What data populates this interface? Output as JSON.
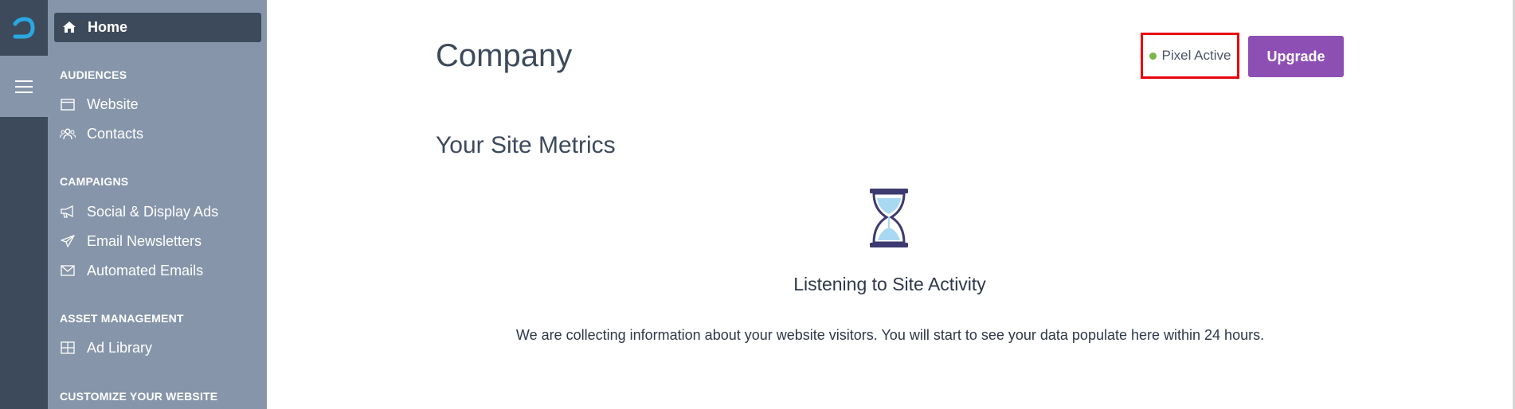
{
  "nav": {
    "logo_icon": "brand-logo-icon",
    "menu_icon": "hamburger-icon",
    "home": {
      "label": "Home",
      "icon": "home-icon"
    },
    "sections": [
      {
        "title": "AUDIENCES",
        "items": [
          {
            "label": "Website",
            "icon": "browser-window-icon"
          },
          {
            "label": "Contacts",
            "icon": "users-icon"
          }
        ]
      },
      {
        "title": "CAMPAIGNS",
        "items": [
          {
            "label": "Social & Display Ads",
            "icon": "megaphone-icon"
          },
          {
            "label": "Email Newsletters",
            "icon": "paper-plane-icon"
          },
          {
            "label": "Automated Emails",
            "icon": "envelope-icon"
          }
        ]
      },
      {
        "title": "ASSET MANAGEMENT",
        "items": [
          {
            "label": "Ad Library",
            "icon": "grid-icon"
          }
        ]
      },
      {
        "title": "CUSTOMIZE YOUR WEBSITE",
        "items": []
      }
    ]
  },
  "header": {
    "title": "Company",
    "pixel_status": "Pixel Active",
    "pixel_status_color": "#7ab648",
    "upgrade_label": "Upgrade",
    "upgrade_color": "#8e4fb5"
  },
  "metrics": {
    "title": "Your Site Metrics",
    "icon": "hourglass-icon",
    "listening_title": "Listening to Site Activity",
    "listening_text": "We are collecting information about your website visitors. You will start to see your data populate here within 24 hours."
  }
}
